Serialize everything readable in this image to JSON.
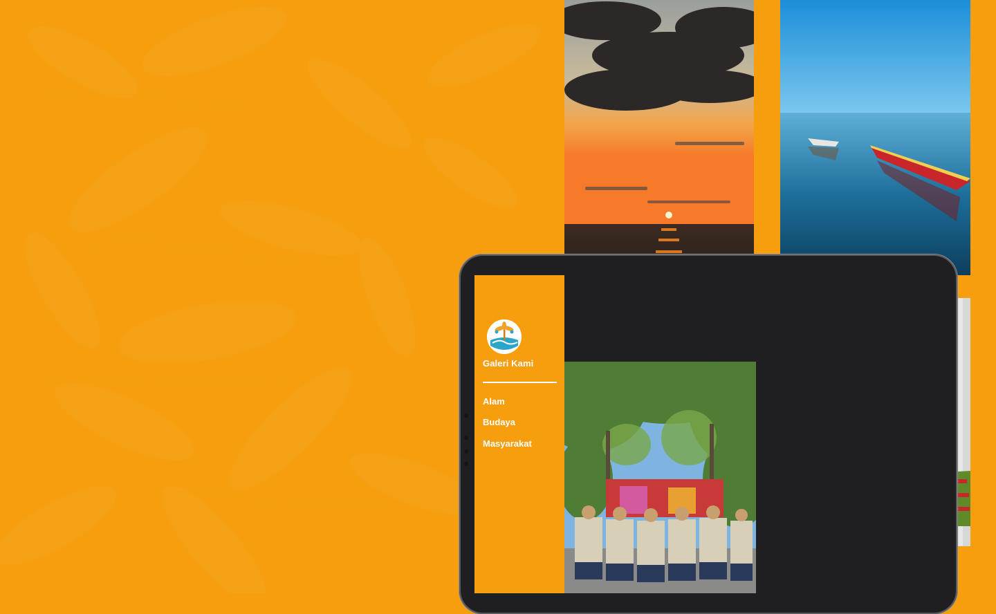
{
  "sidebar": {
    "brand_title": "Galeri Kami",
    "logo_icon": "palm-island-wave-logo",
    "nav": [
      "Alam",
      "Budaya",
      "Masyarakat"
    ]
  },
  "gallery": {
    "photos": [
      {
        "name": "sunset-sea-photo"
      },
      {
        "name": "boats-calm-sea-photo"
      },
      {
        "name": "group-traditional-attire-photo"
      },
      {
        "name": "woman-hijab-waterfall-photo"
      }
    ]
  },
  "colors": {
    "background": "#f79e0e",
    "device_frame": "#1f1f21",
    "text": "#ffffff"
  }
}
